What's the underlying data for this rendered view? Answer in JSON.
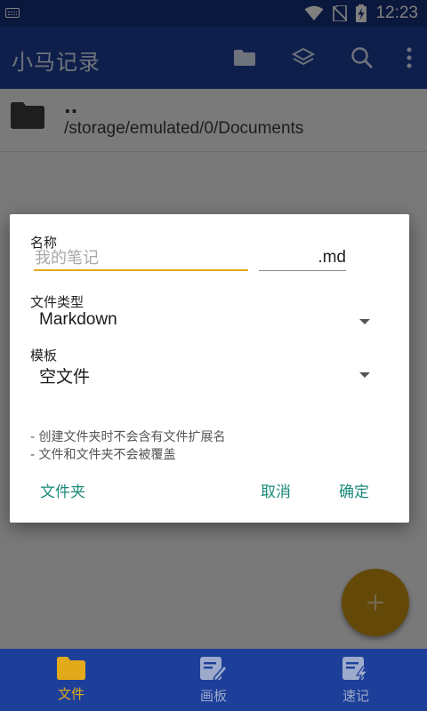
{
  "status_bar": {
    "time": "12:23"
  },
  "app_bar": {
    "title": "小马记录",
    "actions": [
      "folder-icon",
      "layers-icon",
      "search-icon",
      "more-vert-icon"
    ]
  },
  "content": {
    "up_label": "..",
    "path": "/storage/emulated/0/Documents"
  },
  "dialog": {
    "name_label": "名称",
    "name_placeholder": "我的笔记",
    "extension": ".md",
    "file_type_label": "文件类型",
    "file_type_value": "Markdown",
    "template_label": "模板",
    "template_value": "空文件",
    "hints": [
      "- 创建文件夹时不会含有文件扩展名",
      "- 文件和文件夹不会被覆盖"
    ],
    "folder_button": "文件夹",
    "cancel_button": "取消",
    "ok_button": "确定"
  },
  "fab": {
    "icon": "plus-icon"
  },
  "bottom_nav": {
    "items": [
      {
        "label": "文件",
        "icon": "folder-icon",
        "active": true
      },
      {
        "label": "画板",
        "icon": "edit-note-icon",
        "active": false
      },
      {
        "label": "速记",
        "icon": "quick-note-icon",
        "active": false
      }
    ]
  },
  "colors": {
    "primary": "#1d3f99",
    "accent": "#e2aa1b",
    "dialog_button": "#1a8a78"
  }
}
